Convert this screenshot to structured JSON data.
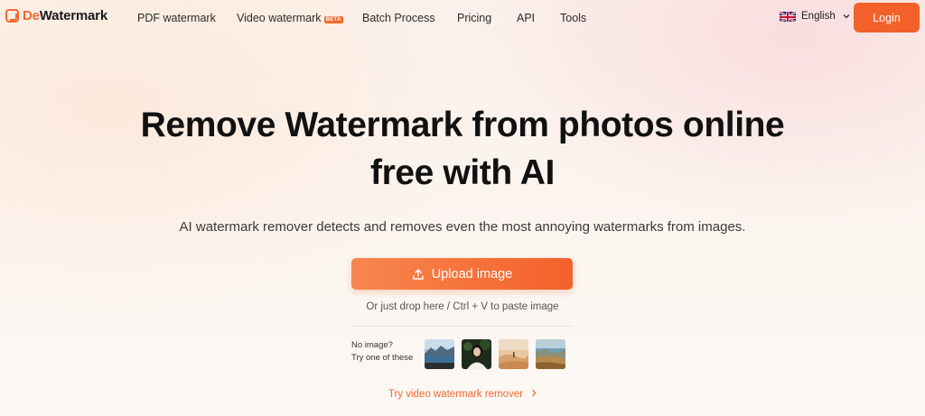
{
  "brand": {
    "prefix": "De",
    "name": "Watermark",
    "accent": "#f26a2e"
  },
  "nav": {
    "items": [
      {
        "label": "PDF watermark"
      },
      {
        "label": "Video watermark",
        "badge": "BETA"
      },
      {
        "label": "Batch Process"
      },
      {
        "label": "Pricing"
      },
      {
        "label": "API"
      },
      {
        "label": "Tools"
      }
    ],
    "language": "English",
    "login_label": "Login"
  },
  "hero": {
    "title_line1": "Remove Watermark from photos online",
    "title_line2": "free with AI",
    "subtitle": "AI watermark remover detects and removes even the most annoying watermarks from images.",
    "upload_label": "Upload image",
    "drop_hint": "Or just drop here / Ctrl + V to paste image",
    "samples_line1": "No image?",
    "samples_line2": "Try one of these",
    "video_link": "Try video watermark remover"
  },
  "icons": {
    "logo": "dewatermark-logo-icon",
    "flag": "uk-flag-icon",
    "chevron": "chevron-down-icon",
    "upload": "upload-icon",
    "link_arrow": "chevron-right-icon"
  },
  "samples": [
    {
      "subject": "lake-mountains"
    },
    {
      "subject": "woman-portrait"
    },
    {
      "subject": "desert-person"
    },
    {
      "subject": "coastal-landscape"
    }
  ]
}
